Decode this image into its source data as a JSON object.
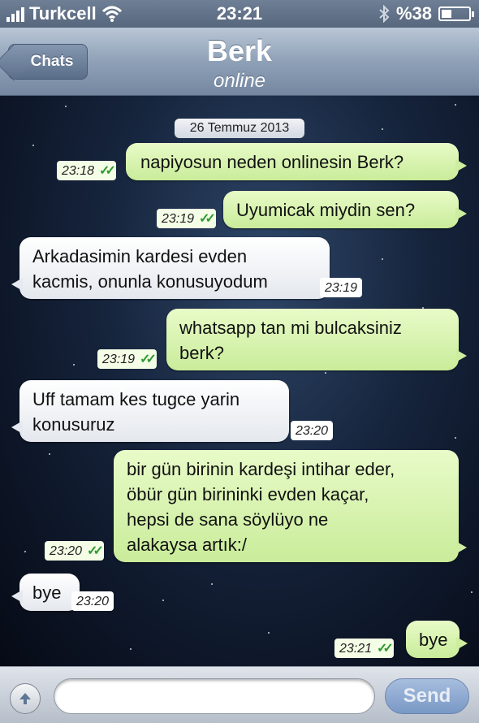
{
  "status_bar": {
    "carrier": "Turkcell",
    "time": "23:21",
    "battery": "%38",
    "battery_level": 0.38
  },
  "nav": {
    "back_label": "Chats",
    "contact_name": "Berk",
    "contact_status": "online"
  },
  "chat": {
    "date": "26 Temmuz 2013",
    "messages": [
      {
        "direction": "out",
        "line1": "napiyosun neden onlinesin Berk?",
        "time": "23:18"
      },
      {
        "direction": "out",
        "line1": "Uyumicak miydin sen?",
        "time": "23:19"
      },
      {
        "direction": "in",
        "line1": "Arkadasimin kardesi evden",
        "line2": "kacmis, onunla konusuyodum",
        "time": "23:19"
      },
      {
        "direction": "out",
        "line1": "whatsapp tan mi bulcaksiniz",
        "line2": "berk?",
        "time": "23:19"
      },
      {
        "direction": "in",
        "line1": "Uff tamam kes tugce yarin",
        "line2": "konusuruz",
        "time": "23:20"
      },
      {
        "direction": "out",
        "line1": "bir gün birinin kardeşi intihar eder,",
        "line2": "öbür gün birininki evden kaçar,",
        "line3": "hepsi de sana söylüyo ne",
        "line4": "alakaysa artık:/",
        "time": "23:20"
      },
      {
        "direction": "in",
        "line1": "bye",
        "time": "23:20"
      },
      {
        "direction": "out",
        "line1": "bye",
        "time": "23:21"
      }
    ]
  },
  "input_bar": {
    "text_value": "",
    "send_label": "Send"
  },
  "colors": {
    "outgoing_bubble": "#d9f5b1",
    "incoming_bubble": "#ffffff",
    "read_check": "#2f9b2f",
    "nav_bar": "#8fa1b7"
  }
}
